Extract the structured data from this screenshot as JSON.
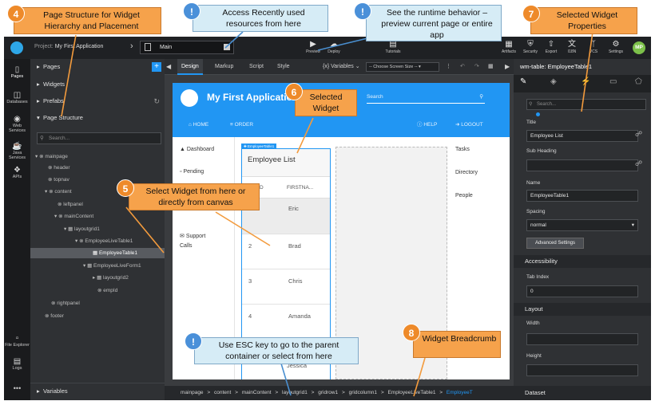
{
  "app": {
    "project_label": "Project: ",
    "project_name": "My First Application",
    "page_selector": "Main"
  },
  "toolbar": {
    "preview": "Preview",
    "deploy": "Deploy",
    "tutorials": "Tutorials",
    "artifacts": "Artifacts",
    "security": "Security",
    "export": "Export",
    "i18n": "I18N",
    "vcs": "VCS",
    "settings": "Settings",
    "avatar": "MP"
  },
  "leftbar": {
    "pages": "Pages",
    "databases": "Databases",
    "web_services": "Web Services",
    "java_services": "Java Services",
    "apis": "APIs",
    "file_explorer": "File Explorer",
    "logs": "Logs",
    "more": "•••"
  },
  "pagepanel": {
    "pages": "Pages",
    "widgets": "Widgets",
    "prefabs": "Prefabs",
    "page_structure": "Page Structure",
    "search_placeholder": "Search...",
    "variables": "Variables",
    "tree": [
      "mainpage",
      "header",
      "topnav",
      "content",
      "leftpanel",
      "mainContent",
      "layoutgrid1",
      "EmployeeLiveTable1",
      "EmployeeTable1",
      "EmployeeLiveForm1",
      "layoutgrid2",
      "empId",
      "rightpanel",
      "footer"
    ]
  },
  "canvas_tabs": {
    "design": "Design",
    "markup": "Markup",
    "script": "Script",
    "style": "Style",
    "variables": "Variables",
    "screen_size": "-- Choose Screen Size --"
  },
  "preview_app": {
    "title": "My First Application",
    "search": "Search",
    "nav_home": "HOME",
    "nav_order": "ORDER",
    "nav_help": "HELP",
    "nav_logout": "LOGOUT",
    "side_dashboard": "Dashboard",
    "side_pending": "Pending",
    "side_support": "Support",
    "side_calls": "Calls",
    "tag": "EmployeeTable1",
    "table_title": "Employee List",
    "col_id": "D",
    "col_first": "FIRSTNA...",
    "rows": [
      {
        "id": "",
        "name": "Eric"
      },
      {
        "id": "2",
        "name": "Brad"
      },
      {
        "id": "3",
        "name": "Chris"
      },
      {
        "id": "4",
        "name": "Amanda"
      },
      {
        "id": "",
        "name": "Jessica"
      }
    ],
    "right_tasks": "Tasks",
    "right_directory": "Directory",
    "right_people": "People"
  },
  "breadcrumb": [
    "mainpage",
    ">",
    "content",
    ">",
    "mainContent",
    ">",
    "layoutgrid1",
    ">",
    "gridrow1",
    ">",
    "gridcolumn1",
    ">",
    "EmployeeLiveTable1",
    ">",
    "EmployeeT"
  ],
  "props": {
    "header": "wm-table: EmployeeTable1",
    "search_placeholder": "Search...",
    "title_label": "Title",
    "title_value": "Employee List",
    "subheading_label": "Sub Heading",
    "subheading_value": "",
    "name_label": "Name",
    "name_value": "EmployeeTable1",
    "spacing_label": "Spacing",
    "spacing_value": "normal",
    "advanced": "Advanced Settings",
    "accessibility": "Accessibility",
    "tabindex_label": "Tab Index",
    "tabindex_value": "0",
    "layout": "Layout",
    "width_label": "Width",
    "height_label": "Height",
    "dataset": "Dataset"
  },
  "callouts": {
    "c4": "Page Structure for Widget Hierarchy and Placement",
    "c1": "Access Recently used resources from here",
    "c2": "See the runtime behavior – preview current page or entire app",
    "c7": "Selected Widget Properties",
    "c6": "Selected Widget",
    "c5": "Select  Widget from here or directly from canvas",
    "c3": "Use ESC key to go to the parent container or select from here",
    "c8": "Widget Breadcrumb",
    "n4": "4",
    "n1": "!",
    "n2": "!",
    "n7": "7",
    "n6": "6",
    "n5": "5",
    "n3": "!",
    "n8": "8"
  },
  "colors": {
    "accent_blue": "#2196f3",
    "callout_orange": "#f6a24b",
    "callout_blue": "#d6ecf6",
    "selection": "#585b60"
  }
}
